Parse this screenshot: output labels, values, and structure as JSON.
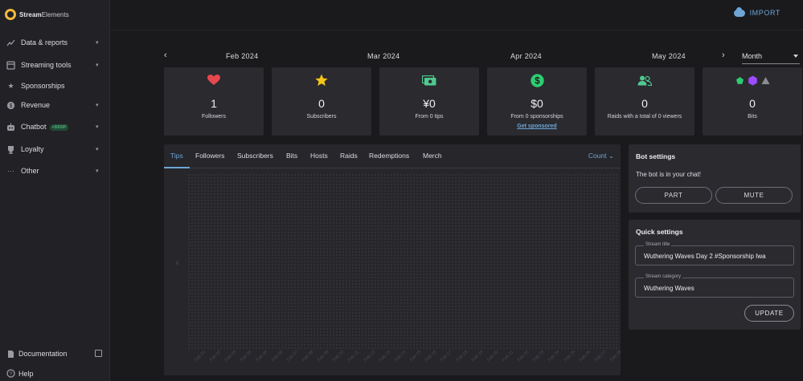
{
  "app": {
    "logo_text_brand": "Stream",
    "logo_text_rest": "Elements"
  },
  "sidebar": {
    "items": [
      {
        "label": "Data & reports",
        "icon": "chart-line-icon",
        "has_chevron": true
      },
      {
        "label": "Streaming tools",
        "icon": "tools-icon",
        "has_chevron": true
      },
      {
        "label": "Sponsorships",
        "icon": "star-icon",
        "has_chevron": false
      },
      {
        "label": "Revenue",
        "icon": "dollar-circle-icon",
        "has_chevron": true
      },
      {
        "label": "Chatbot",
        "icon": "robot-icon",
        "has_chevron": true,
        "badge": "+500XP"
      },
      {
        "label": "Loyalty",
        "icon": "trophy-icon",
        "has_chevron": true
      },
      {
        "label": "Other",
        "icon": "dots-icon",
        "has_chevron": true
      }
    ],
    "bottom": [
      {
        "label": "Documentation",
        "icon": "document-icon"
      },
      {
        "label": "Help",
        "icon": "help-icon"
      }
    ]
  },
  "topbar": {
    "import_label": "IMPORT"
  },
  "months": {
    "labels": [
      "Feb 2024",
      "Mar 2024",
      "Apr 2024",
      "May 2024"
    ],
    "period": "Month",
    "prev_icon": "chevron-left-icon",
    "next_icon": "chevron-right-icon"
  },
  "stats": [
    {
      "value": "1",
      "label": "Followers",
      "icon": "heart-icon",
      "color": "#e5484d"
    },
    {
      "value": "0",
      "label": "Subscribers",
      "icon": "star-icon",
      "color": "#f5c518"
    },
    {
      "value": "¥0",
      "label": "From 0 tips",
      "icon": "money-icon",
      "color": "#4fc98f"
    },
    {
      "value": "$0",
      "label": "From 0 sponsorships",
      "link": "Get sponsored",
      "icon": "dollar-circle-icon",
      "color": "#2ecc71"
    },
    {
      "value": "0",
      "label": "Raids with a total of 0 viewers",
      "icon": "users-icon",
      "color": "#4fc98f"
    },
    {
      "value": "0",
      "label": "Bits",
      "icon": "bits-icon",
      "colors": [
        "#2ecc71",
        "#9b4dff",
        "#8a8a92"
      ]
    }
  ],
  "chart": {
    "tabs": [
      "Tips",
      "Followers",
      "Subscribers",
      "Bits",
      "Hosts",
      "Raids",
      "Redemptions",
      "Merch"
    ],
    "active_tab": "Tips",
    "metric": "Count",
    "y_tick": "0",
    "x_ticks": [
      "Feb 01",
      "Feb 02",
      "Feb 03",
      "Feb 04",
      "Feb 05",
      "Feb 06",
      "Feb 07",
      "Feb 08",
      "Feb 09",
      "Feb 10",
      "Feb 11",
      "Feb 12",
      "Feb 13",
      "Feb 14",
      "Feb 15",
      "Feb 16",
      "Feb 17",
      "Feb 18",
      "Feb 19",
      "Feb 20",
      "Feb 21",
      "Feb 22",
      "Feb 23",
      "Feb 24",
      "Feb 25",
      "Feb 26",
      "Feb 27",
      "Feb 28"
    ]
  },
  "chart_data": {
    "type": "line",
    "categories": [
      "Feb 01",
      "Feb 02",
      "Feb 03",
      "Feb 04",
      "Feb 05",
      "Feb 06",
      "Feb 07",
      "Feb 08",
      "Feb 09",
      "Feb 10",
      "Feb 11",
      "Feb 12",
      "Feb 13",
      "Feb 14",
      "Feb 15",
      "Feb 16",
      "Feb 17",
      "Feb 18",
      "Feb 19",
      "Feb 20",
      "Feb 21",
      "Feb 22",
      "Feb 23",
      "Feb 24",
      "Feb 25",
      "Feb 26",
      "Feb 27",
      "Feb 28"
    ],
    "series": [
      {
        "values": [
          0,
          0,
          0,
          0,
          0,
          0,
          0,
          0,
          0,
          0,
          0,
          0,
          0,
          0,
          0,
          0,
          0,
          0,
          0,
          0,
          0,
          0,
          0,
          0,
          0,
          0,
          0,
          0
        ]
      }
    ],
    "ylabel": "Count",
    "yticks": [
      "0"
    ]
  },
  "bot_settings": {
    "title": "Bot settings",
    "status_text": "The bot is in your chat!",
    "part_label": "PART",
    "mute_label": "MUTE"
  },
  "quick_settings": {
    "title": "Quick settings",
    "stream_title_label": "Stream title",
    "stream_title_value": "Wuthering Waves Day 2 #Sponsorship Iwa",
    "stream_category_label": "Stream category",
    "stream_category_value": "Wuthering Waves",
    "update_label": "UPDATE"
  }
}
